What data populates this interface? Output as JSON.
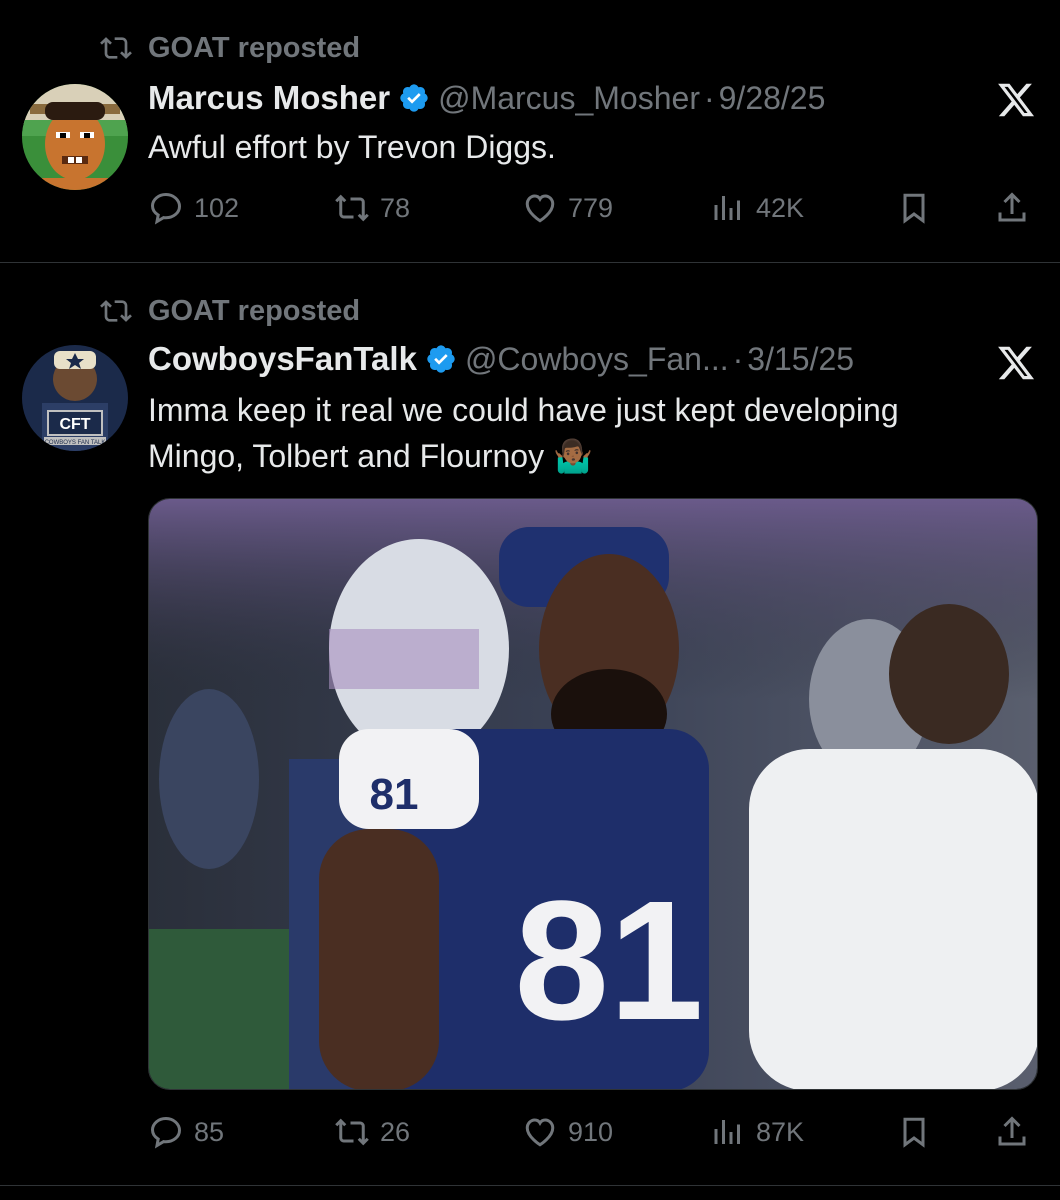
{
  "tweets": [
    {
      "repost_text": "GOAT reposted",
      "name": "Marcus Mosher",
      "handle": "@Marcus_Mosher",
      "date": "9/28/25",
      "text": "Awful effort by Trevon Diggs.",
      "replies": "102",
      "reposts": "78",
      "likes": "779",
      "views": "42K"
    },
    {
      "repost_text": "GOAT reposted",
      "name": "CowboysFanTalk",
      "handle": "@Cowboys_Fan...",
      "date": "3/15/25",
      "text_line1": "Imma keep it real we could have just kept developing",
      "text_line2": "Mingo, Tolbert and Flournoy 🤷🏾‍♂️",
      "replies": "85",
      "reposts": "26",
      "likes": "910",
      "views": "87K",
      "avatar_text": "CFT",
      "avatar_subtext": "COWBOYS FAN TALK",
      "jersey_number": "81"
    }
  ],
  "separator": "·",
  "colors": {
    "background": "#000000",
    "text": "#e7e9ea",
    "muted": "#71767b",
    "verified": "#1d9bf0",
    "border": "#2f3336"
  }
}
